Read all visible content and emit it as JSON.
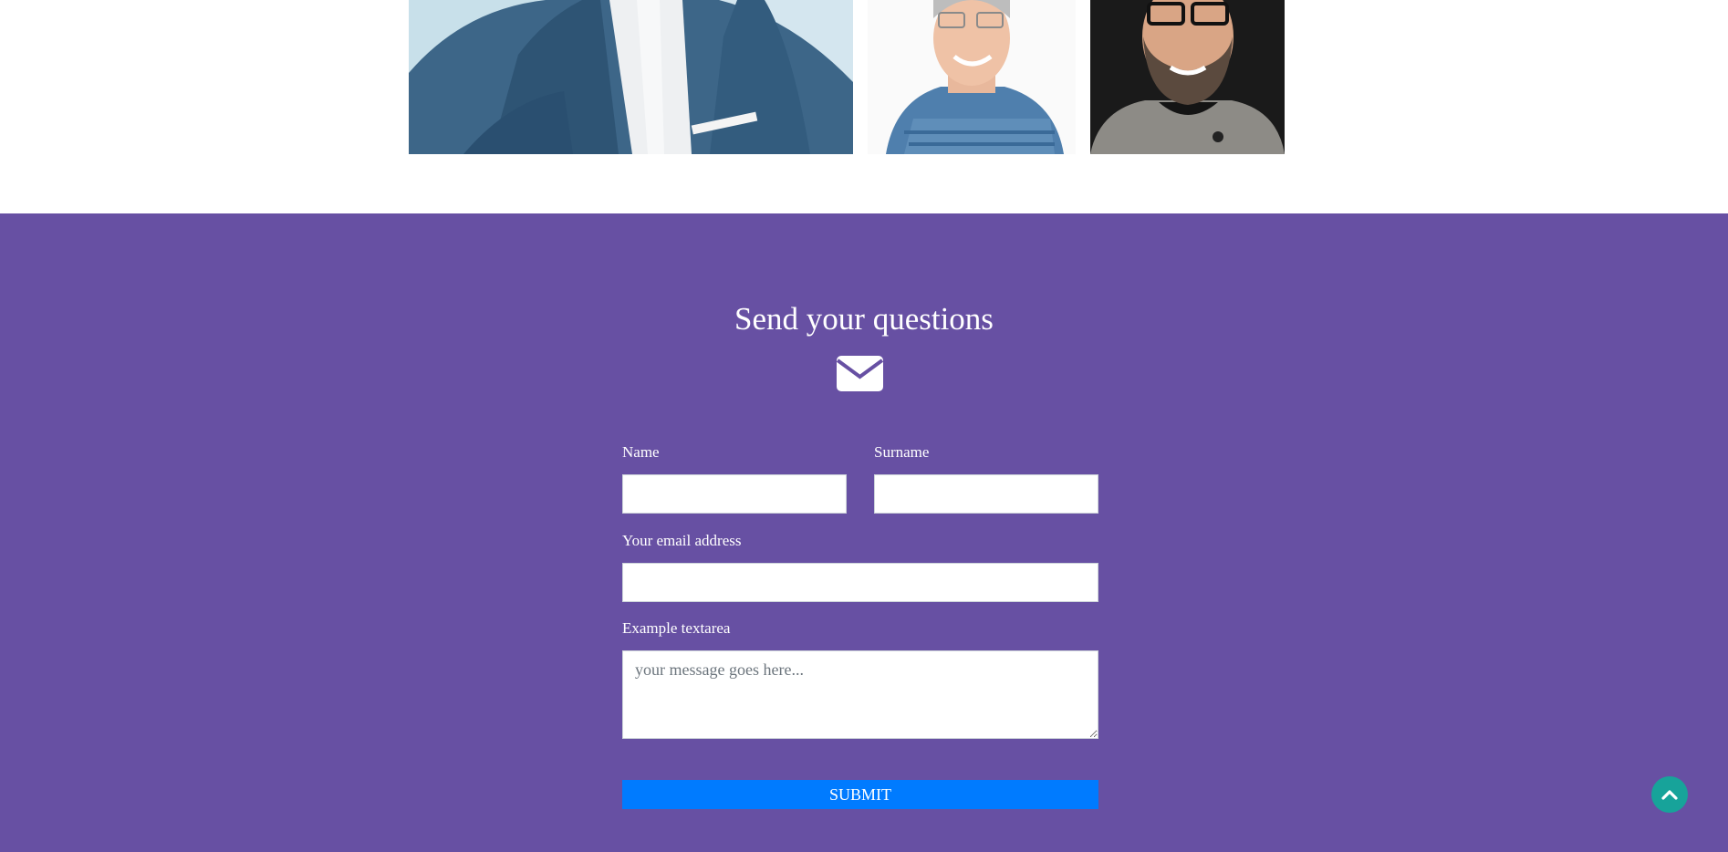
{
  "team_photos": [
    {
      "alt": "Man in blue suit"
    },
    {
      "alt": "Smiling grey-haired man in blue hoodie"
    },
    {
      "alt": "Bearded man with glasses"
    }
  ],
  "contact": {
    "title": "Send your questions",
    "mail_icon": "envelope-icon",
    "background_color": "#6750a3",
    "name_label": "Name",
    "surname_label": "Surname",
    "email_label": "Your email address",
    "textarea_label": "Example textarea",
    "name_value": "",
    "surname_value": "",
    "email_value": "",
    "textarea_placeholder": "your message goes here...",
    "submit_label": "SUBMIT",
    "submit_color": "#007bff"
  },
  "back_to_top": {
    "icon": "chevron-up-icon",
    "color": "#17a39a"
  }
}
